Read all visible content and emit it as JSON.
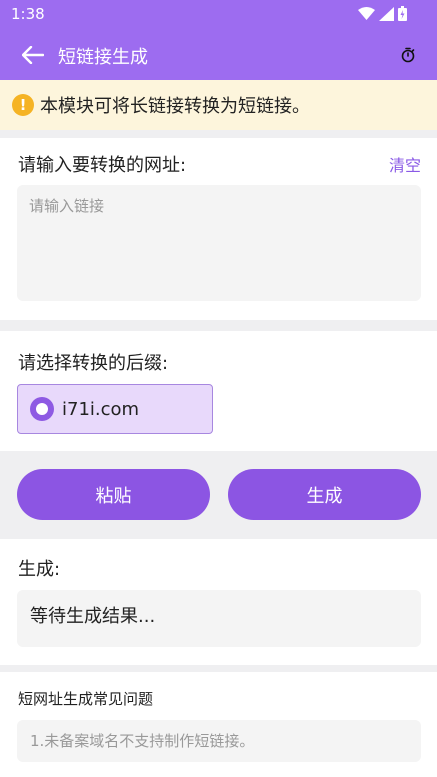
{
  "status": {
    "time": "1:38"
  },
  "toolbar": {
    "title": "短链接生成"
  },
  "notice": {
    "text": "本模块可将长链接转换为短链接。"
  },
  "input_section": {
    "label": "请输入要转换的网址:",
    "clear_label": "清空",
    "placeholder": "请输入链接",
    "value": ""
  },
  "suffix_section": {
    "label": "请选择转换的后缀:",
    "options": [
      {
        "label": "i71i.com",
        "selected": true
      }
    ]
  },
  "actions": {
    "paste_label": "粘贴",
    "generate_label": "生成"
  },
  "result_section": {
    "label": "生成:",
    "value": "等待生成结果..."
  },
  "faq": {
    "title": "短网址生成常见问题",
    "items": [
      "1.未备案域名不支持制作短链接。"
    ]
  },
  "colors": {
    "accent": "#8c55e3",
    "appbar": "#9d6cf0",
    "notice_bg": "#fdf5dc",
    "warning": "#f5b324"
  }
}
